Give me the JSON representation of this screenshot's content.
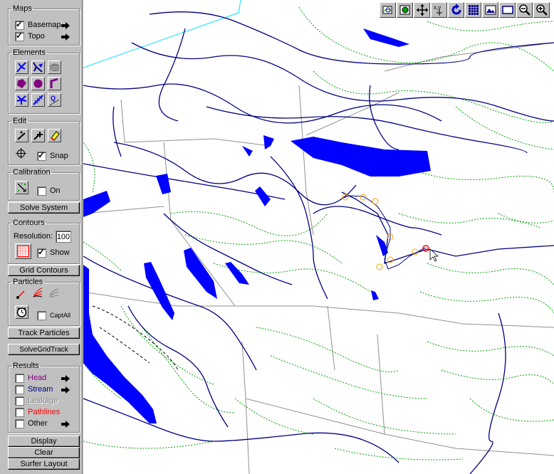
{
  "maps": {
    "title": "Maps",
    "basemap": "Basemap",
    "topo": "Topo",
    "basemap_checked": true,
    "topo_checked": true
  },
  "elements": {
    "title": "Elements"
  },
  "edit": {
    "title": "Edit",
    "snap": "Snap",
    "snap_checked": true
  },
  "calibration": {
    "title": "Calibration",
    "on": "On",
    "on_checked": false,
    "solve": "Solve System"
  },
  "contours": {
    "title": "Contours",
    "resolution_label": "Resolution:",
    "resolution_value": "100",
    "show": "Show",
    "show_checked": true,
    "grid": "Grid Contours"
  },
  "particles": {
    "title": "Particles",
    "captall": "CaptAll",
    "captall_checked": false,
    "track": "Track Particles"
  },
  "solvegridtrack": "SolveGridTrack",
  "results": {
    "title": "Results",
    "items": [
      {
        "label": "Head",
        "color": "#800080"
      },
      {
        "label": "Stream",
        "color": "#000080"
      },
      {
        "label": "Leakage",
        "color": "#808080"
      },
      {
        "label": "Pathlines",
        "color": "#ff0000"
      },
      {
        "label": "Other",
        "color": "#000000"
      }
    ]
  },
  "bottom": {
    "display": "Display",
    "clear": "Clear",
    "surfer": "Surfer Layout"
  },
  "toolbar_icons": [
    "zoom-to-extent-icon",
    "zoom-layer-icon",
    "pan-icon",
    "xy-coordinates-icon",
    "redraw-icon",
    "grid-icon",
    "map-image-icon",
    "window-icon",
    "zoom-out-icon",
    "zoom-in-icon"
  ],
  "colors": {
    "water": "#0000ff",
    "river": "#000080",
    "contour": "#00a000",
    "road": "#808080",
    "pathline": "#ffa000"
  }
}
